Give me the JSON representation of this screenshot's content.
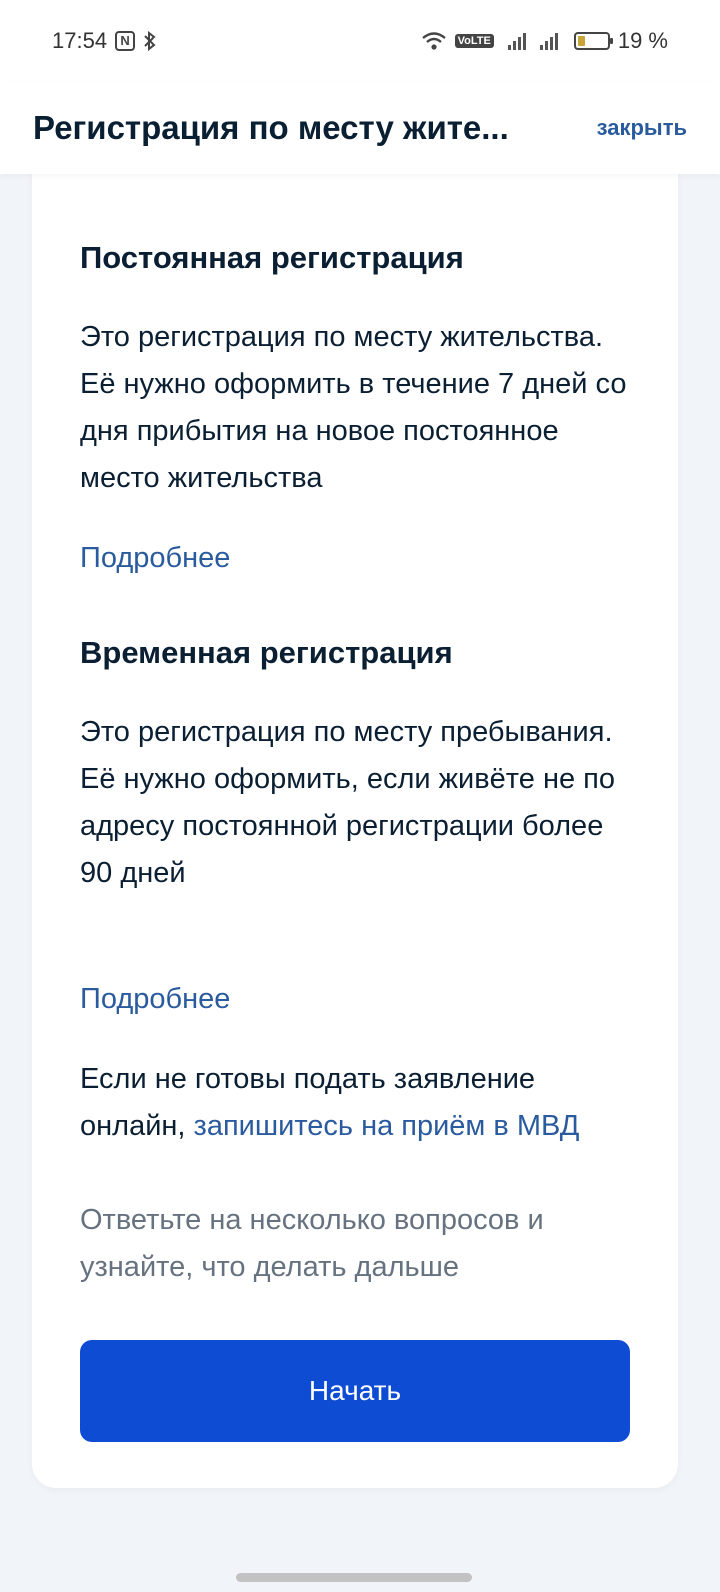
{
  "status_bar": {
    "time": "17:54",
    "nfc_glyph": "N",
    "volte": "VoLTE",
    "battery_percent": "19 %",
    "icons": [
      "nfc-icon",
      "bluetooth-icon",
      "wifi-icon",
      "volte-icon",
      "signal-icon",
      "battery-icon"
    ]
  },
  "header": {
    "title": "Регистрация по месту жите...",
    "close_label": "закрыть"
  },
  "sections": {
    "permanent": {
      "title": "Постоянная регистрация",
      "text": "Это регистрация по месту жительства. Её нужно оформить в течение 7 дней со дня прибытия на новое постоянное место жительства",
      "more": "Подробнее"
    },
    "temporary": {
      "title": "Временная регистрация",
      "text": "Это регистрация по месту пребывания. Её нужно оформить, если живёте не по адресу постоянной регистрации более 90 дней",
      "more": "Подробнее"
    }
  },
  "offline_note": {
    "prefix": "Если не готовы подать заявление онлайн, ",
    "link": "запишитесь на приём в МВД"
  },
  "hint": "Ответьте на несколько вопросов и узнайте, что делать дальше",
  "start_button": "Начать",
  "colors": {
    "primary_button": "#0d4cd3",
    "link": "#2a5b9e",
    "heading": "#0b1f33",
    "muted_text": "#66727f",
    "page_bg": "#f1f4f8"
  }
}
